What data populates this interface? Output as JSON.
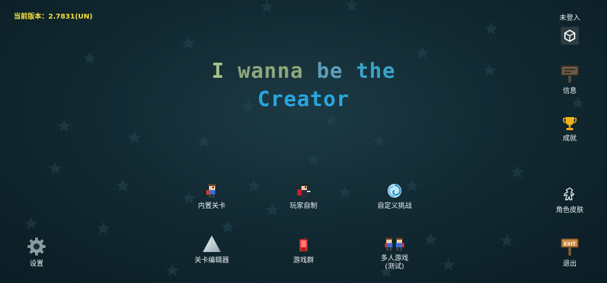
{
  "version_text": "当前版本：2.7831(UN)",
  "title": {
    "line1": [
      "I",
      "wanna",
      "be",
      "the"
    ],
    "line2": "Creator"
  },
  "right_menu": {
    "login": "未登入",
    "info": "信息",
    "achievements": "成就",
    "skins": "角色皮肤",
    "exit": "退出"
  },
  "main_menu": {
    "builtin_levels": "内置关卡",
    "player_made": "玩家自制",
    "custom_challenge": "自定义挑战",
    "level_editor": "关卡编辑器",
    "game_group": "游戏群",
    "multiplayer_line1": "多人游戏",
    "multiplayer_line2": "(测试)"
  },
  "settings": "设置",
  "icons": {
    "login": "unity-logo-icon",
    "info": "signboard-icon",
    "achievements": "trophy-icon",
    "skins": "character-outline-icon",
    "exit": "exit-sign-icon",
    "builtin_levels": "kid-character-icon",
    "player_made": "caped-kid-icon",
    "custom_challenge": "swirl-portal-icon",
    "level_editor": "spike-triangle-icon",
    "game_group": "phone-icon",
    "multiplayer": "two-kids-icon",
    "settings": "gear-icon"
  },
  "colors": {
    "version": "#f2e23a",
    "title_creator": "#2aa6e0",
    "background": "#122a33"
  }
}
